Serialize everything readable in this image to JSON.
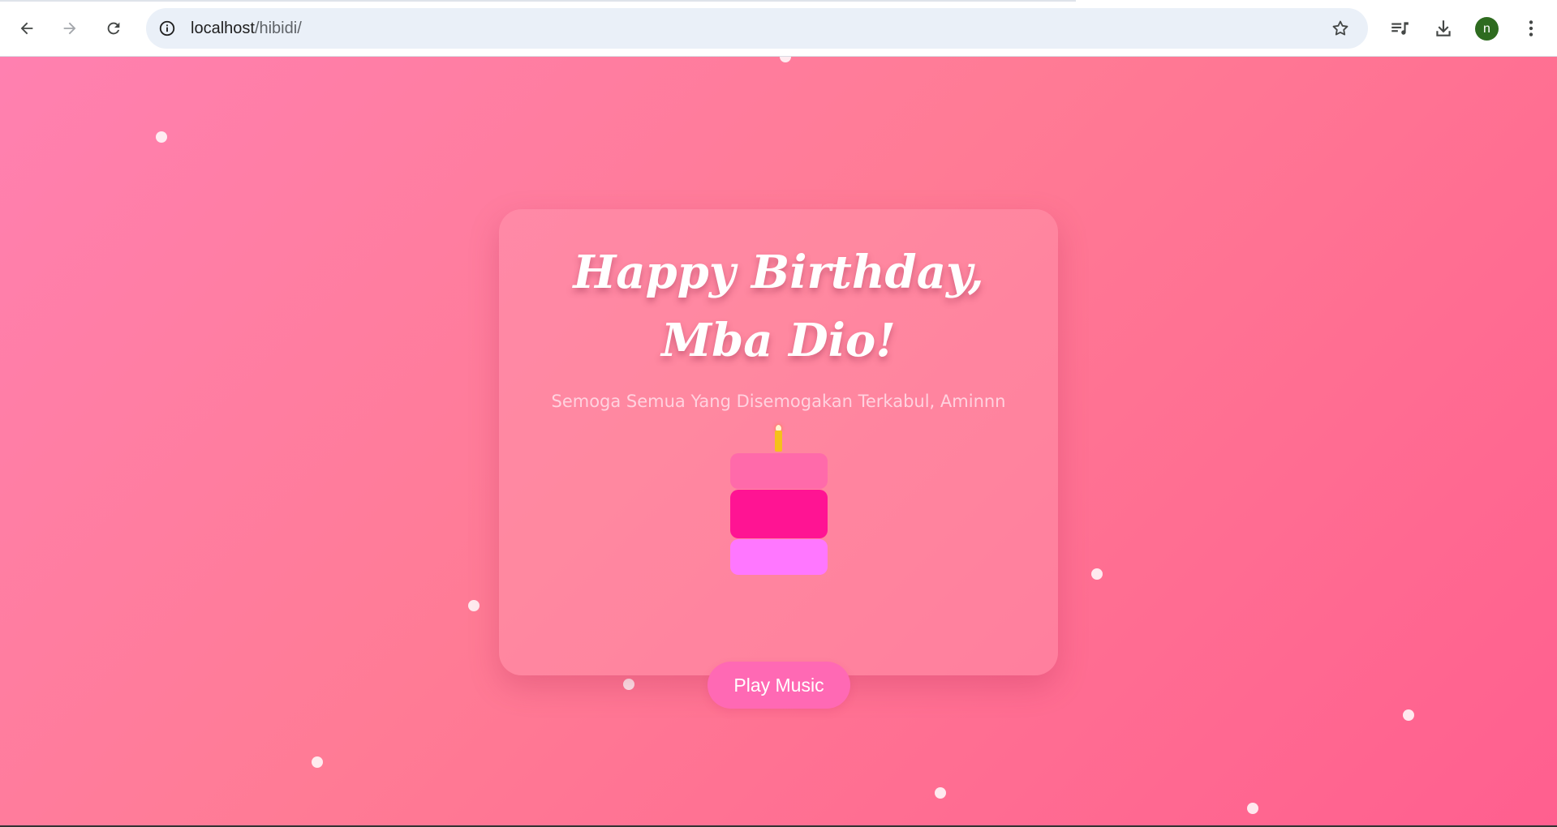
{
  "browser": {
    "url_host": "localhost",
    "url_path": "/hibidi/",
    "profile_initial": "n",
    "icons": {
      "back": "arrow-left-icon",
      "forward": "arrow-right-icon",
      "reload": "reload-icon",
      "site_info": "info-icon",
      "bookmark": "star-icon",
      "media": "media-queue-icon",
      "downloads": "download-icon",
      "menu": "kebab-menu-icon"
    }
  },
  "card": {
    "title": "Happy Birthday, Mba Dio!",
    "subtitle": "Semoga Semua Yang Disemogakan Terkabul, Aminnn",
    "button_label": "Play Music"
  },
  "colors": {
    "background_start": "#ff80b0",
    "background_end": "#ff5f8f",
    "cake_top": "#ff6aaa",
    "cake_middle": "#ff1493",
    "cake_bottom": "#ff77ff",
    "candle": "#f5c11b",
    "button": "#ff69b4"
  }
}
